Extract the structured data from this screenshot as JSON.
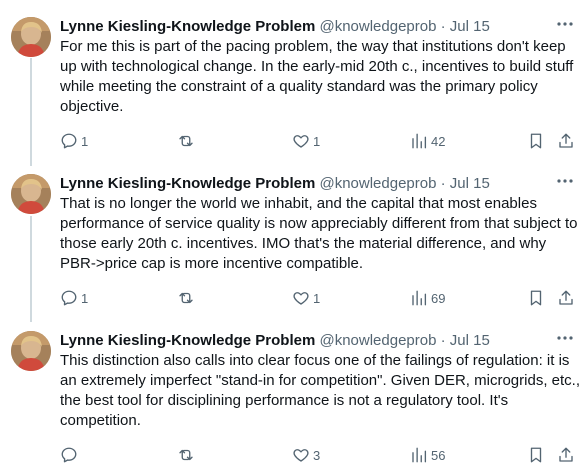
{
  "tweets": [
    {
      "author": {
        "name": "Lynne Kiesling-Knowledge Problem",
        "handle": "@knowledgeprob",
        "separator": "·",
        "date": "Jul 15"
      },
      "text": "For me this is part of the pacing problem, the way that institutions don't keep up with technological change. In the early-mid 20th c., incentives to build stuff while meeting the constraint of a quality standard was the primary policy objective.",
      "counts": {
        "replies": "1",
        "reposts": "",
        "likes": "1",
        "views": "42"
      }
    },
    {
      "author": {
        "name": "Lynne Kiesling-Knowledge Problem",
        "handle": "@knowledgeprob",
        "separator": "·",
        "date": "Jul 15"
      },
      "text": "That is no longer the world we inhabit, and the capital that most enables performance of service quality is now appreciably different from that subject to those early 20th c. incentives. IMO that's the material difference, and why PBR->price cap is more incentive compatible.",
      "counts": {
        "replies": "1",
        "reposts": "",
        "likes": "1",
        "views": "69"
      }
    },
    {
      "author": {
        "name": "Lynne Kiesling-Knowledge Problem",
        "handle": "@knowledgeprob",
        "separator": "·",
        "date": "Jul 15"
      },
      "text": "This distinction also calls into clear focus one of the failings of regulation: it is an extremely imperfect \"stand-in for competition\". Given DER, microgrids, etc., the best tool for disciplining performance is not a regulatory tool. It's competition.",
      "counts": {
        "replies": "",
        "reposts": "",
        "likes": "3",
        "views": "56"
      }
    }
  ],
  "icons": {
    "more": "more-horizontal-icon",
    "reply": "reply-icon",
    "repost": "repost-icon",
    "like": "like-icon",
    "views": "views-icon",
    "bookmark": "bookmark-icon",
    "share": "share-icon"
  },
  "colors": {
    "text": "#0f1419",
    "secondary": "#536471",
    "thread_line": "#cfd9de"
  }
}
